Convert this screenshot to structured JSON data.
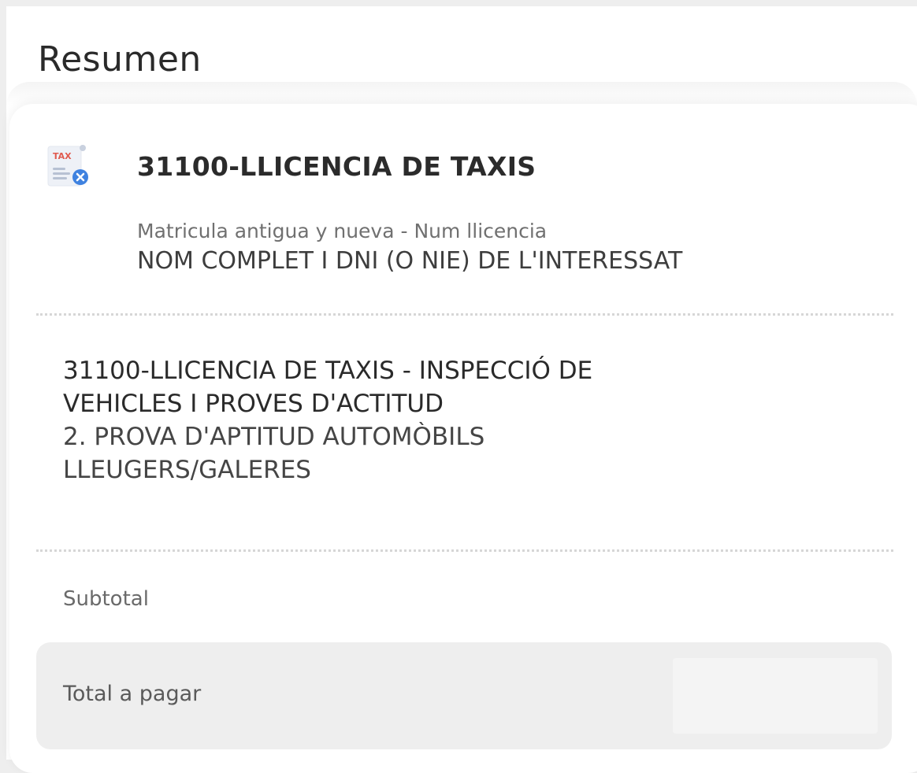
{
  "header": {
    "title": "Resumen"
  },
  "item": {
    "icon": "tax-document-icon",
    "icon_text": "TAX",
    "title": "31100-LLICENCIA DE TAXIS",
    "subtitle": "Matricula antigua y nueva - Num llicencia",
    "person": "NOM COMPLET I DNI (O NIE) DE L'INTERESSAT"
  },
  "concept": {
    "name": "31100-LLICENCIA DE TAXIS - INSPECCIÓ DE VEHICLES I PROVES D'ACTITUD",
    "detail": "2. PROVA D'APTITUD AUTOMÒBILS LLEUGERS/GALERES"
  },
  "summary": {
    "subtotal_label": "Subtotal",
    "total_label": "Total a pagar"
  },
  "colors": {
    "icon_red": "#e05a4f",
    "icon_blue": "#3f82e0",
    "total_background": "#eeeeee"
  }
}
